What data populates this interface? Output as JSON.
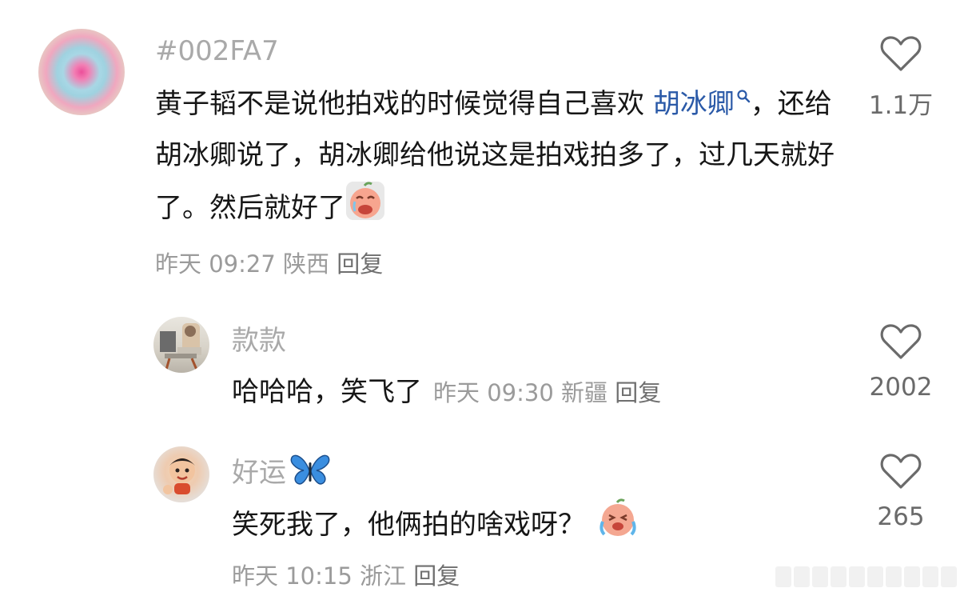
{
  "comments": [
    {
      "username": "#002FA7",
      "text_before": "黄子韬不是说他拍戏的时候觉得自己喜欢 ",
      "mention": "胡冰卿",
      "text_after": "，还给胡冰卿说了，胡冰卿给他说这是拍戏拍多了，过几天就好了。然后就好了",
      "time": "昨天 09:27",
      "location": "陕西",
      "reply": "回复",
      "likes": "1.1万",
      "emoji": "crying-face-emoji"
    },
    {
      "username": "款款",
      "text": "哈哈哈，笑飞了",
      "time": "昨天 09:30",
      "location": "新疆",
      "reply": "回复",
      "likes": "2002"
    },
    {
      "username": "好运",
      "username_emoji": "butterfly-emoji",
      "text": "笑死我了，他俩拍的啥戏呀？",
      "time": "昨天 10:15",
      "location": "浙江",
      "reply": "回复",
      "likes": "265",
      "emoji": "laughing-crying-face-emoji"
    }
  ],
  "colors": {
    "mention": "#2b5aa8",
    "meta": "#9b9b9b",
    "username": "#a9a9a9"
  }
}
